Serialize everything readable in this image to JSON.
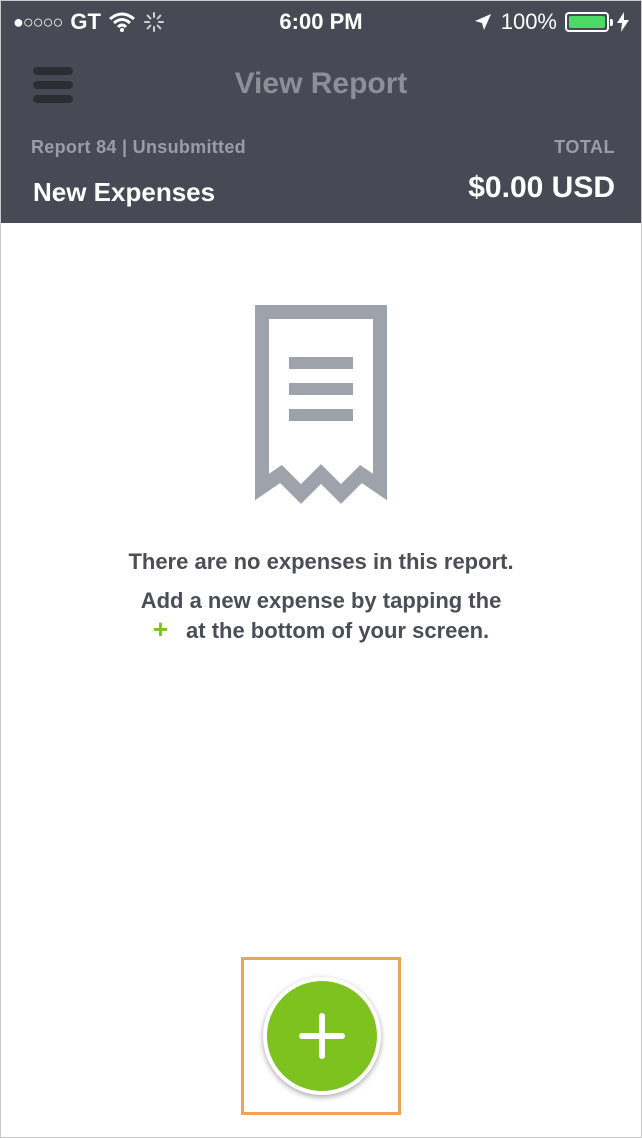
{
  "status_bar": {
    "signal": "●○○○○",
    "carrier": "GT",
    "time": "6:00 PM",
    "battery": "100%"
  },
  "header": {
    "title": "View Report",
    "report_meta": "Report 84 | Unsubmitted",
    "total_label": "TOTAL",
    "report_name": "New Expenses",
    "total_value": "$0.00 USD"
  },
  "empty_state": {
    "line1": "There are no expenses in this report.",
    "line2": "Add a new expense by tapping the",
    "plus_glyph": "+",
    "line3": "at the bottom of your screen."
  },
  "colors": {
    "header_bg": "#474a54",
    "accent_green": "#7dc21e",
    "highlight": "#f0a258",
    "battery": "#4cd964"
  }
}
